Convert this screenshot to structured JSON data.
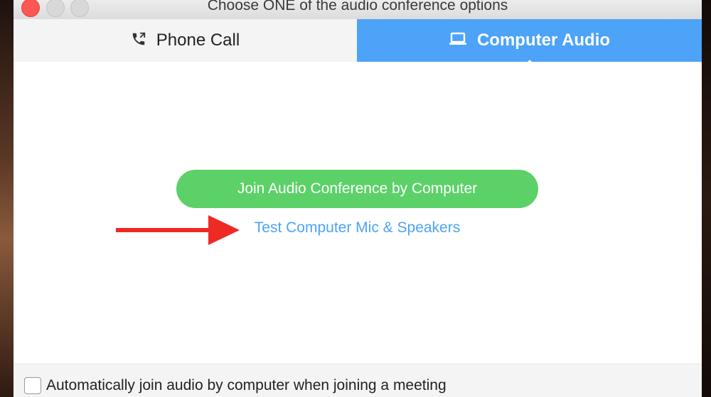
{
  "window": {
    "title": "Choose ONE of the audio conference options"
  },
  "tabs": [
    {
      "label": "Phone Call",
      "icon": "phone-icon"
    },
    {
      "label": "Computer Audio",
      "icon": "laptop-icon"
    }
  ],
  "main": {
    "join_button_label": "Join Audio Conference by Computer",
    "test_link_label": "Test Computer Mic & Speakers",
    "annotation_icon": "red-arrow-icon"
  },
  "footer": {
    "auto_join_label": "Automatically join audio by computer when joining a meeting",
    "auto_join_checked": false
  },
  "colors": {
    "accent": "#4da3f7",
    "join_button": "#5bd168",
    "annotation_arrow": "#ee2a24",
    "close_button": "#fc5753"
  }
}
